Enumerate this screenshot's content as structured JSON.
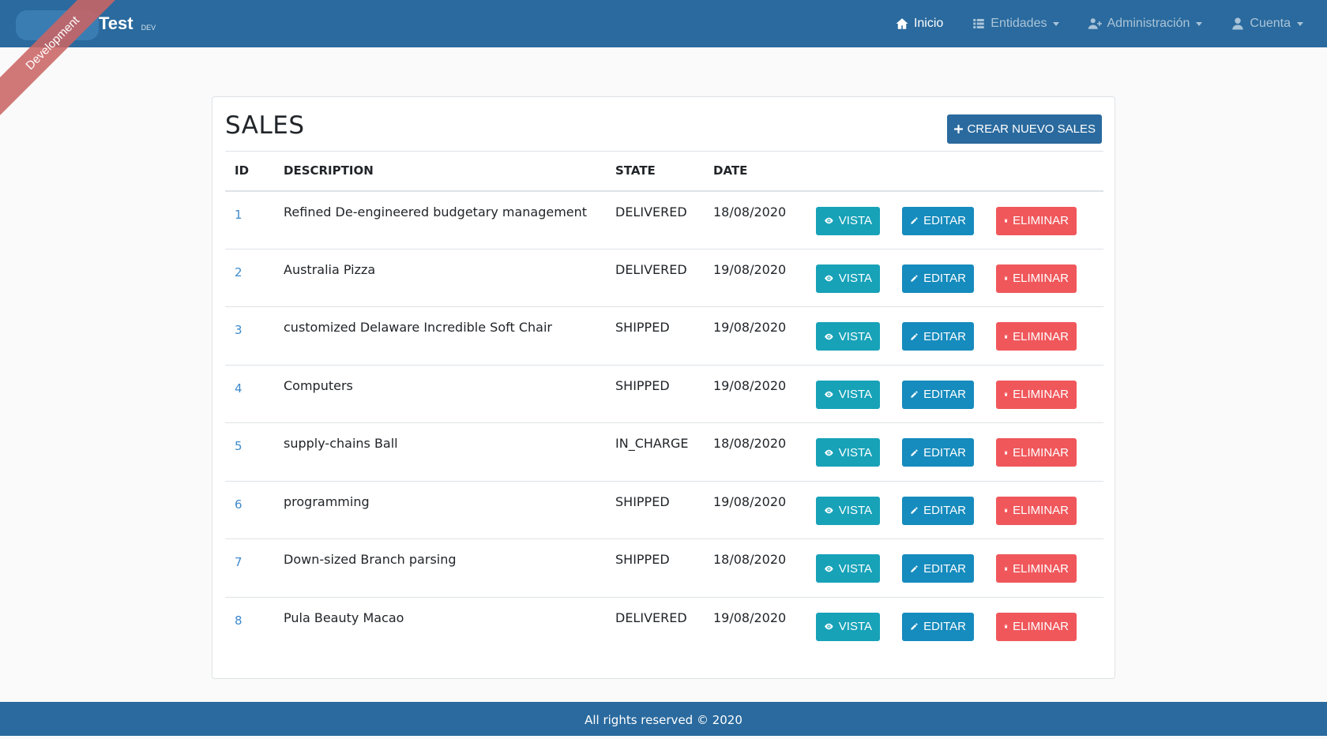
{
  "brand": {
    "title": "Test",
    "version": "DEV",
    "ribbon": "Development"
  },
  "nav": {
    "items": [
      {
        "label": "Inicio",
        "icon": "home-icon",
        "active": true,
        "dropdown": false
      },
      {
        "label": "Entidades",
        "icon": "list-icon",
        "active": false,
        "dropdown": true
      },
      {
        "label": "Administración",
        "icon": "user-plus-icon",
        "active": false,
        "dropdown": true
      },
      {
        "label": "Cuenta",
        "icon": "user-icon",
        "active": false,
        "dropdown": true
      }
    ]
  },
  "page": {
    "title": "SALES",
    "create_label": "CREAR NUEVO SALES"
  },
  "table": {
    "headers": {
      "id": "ID",
      "description": "DESCRIPTION",
      "state": "STATE",
      "date": "DATE"
    },
    "actions": {
      "view": "VISTA",
      "edit": "EDITAR",
      "delete": "ELIMINAR"
    },
    "rows": [
      {
        "id": "1",
        "description": "Refined De-engineered budgetary management",
        "state": "DELIVERED",
        "date": "18/08/2020"
      },
      {
        "id": "2",
        "description": "Australia Pizza",
        "state": "DELIVERED",
        "date": "19/08/2020"
      },
      {
        "id": "3",
        "description": "customized Delaware Incredible Soft Chair",
        "state": "SHIPPED",
        "date": "19/08/2020"
      },
      {
        "id": "4",
        "description": "Computers",
        "state": "SHIPPED",
        "date": "19/08/2020"
      },
      {
        "id": "5",
        "description": "supply-chains Ball",
        "state": "IN_CHARGE",
        "date": "18/08/2020"
      },
      {
        "id": "6",
        "description": "programming",
        "state": "SHIPPED",
        "date": "19/08/2020"
      },
      {
        "id": "7",
        "description": "Down-sized Branch parsing",
        "state": "SHIPPED",
        "date": "18/08/2020"
      },
      {
        "id": "8",
        "description": "Pula Beauty Macao",
        "state": "DELIVERED",
        "date": "19/08/2020"
      }
    ]
  },
  "footer": {
    "text": "All rights reserved © 2020"
  },
  "colors": {
    "navbar": "#2a6a9e",
    "view_button": "#17a2b8",
    "edit_button": "#168bbd",
    "delete_button": "#f0575b",
    "link": "#3e8acc",
    "ribbon": "#c96464"
  }
}
